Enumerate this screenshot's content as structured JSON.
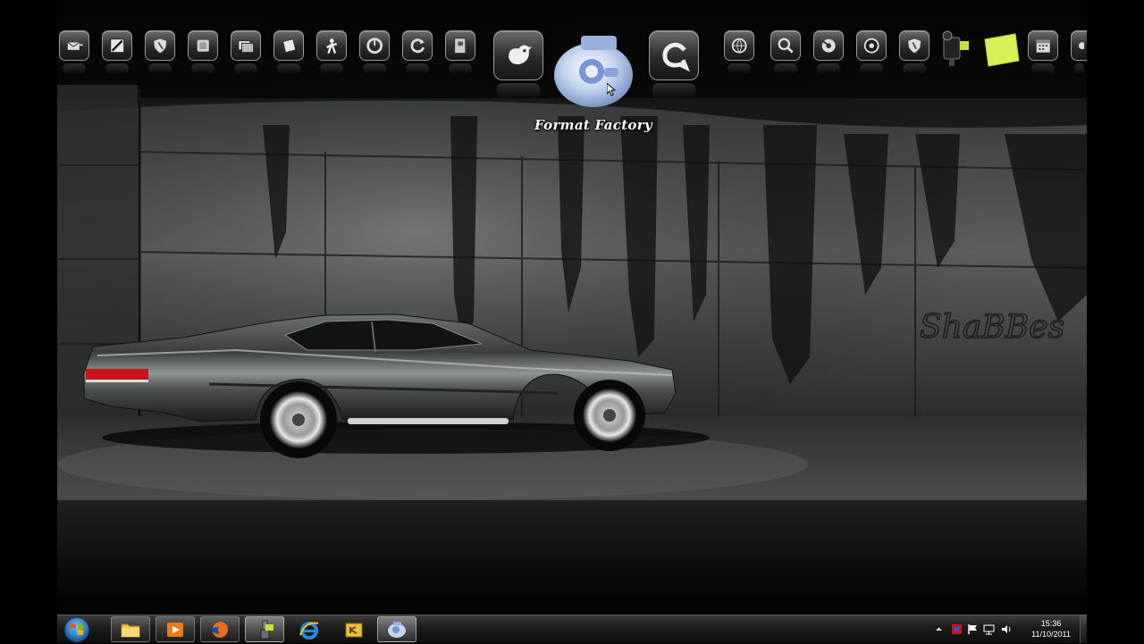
{
  "dock": {
    "hover_label": "Format Factory",
    "icons": [
      "email-icon",
      "draw-icon",
      "shield-icon",
      "app-icon",
      "gallery-icon",
      "note-icon",
      "aim-icon",
      "ccleaner-icon",
      "reload-icon",
      "files-icon",
      "twitter-bird-icon",
      "format-factory-icon",
      "messenger-icon",
      "globe-icon",
      "search-icon",
      "media-icon",
      "speaker-icon",
      "security-icon",
      "camcorder-icon",
      "sticky-note-icon",
      "calendar-icon",
      "partial-icon"
    ]
  },
  "taskbar": {
    "start_label": "Start",
    "buttons": [
      "explorer-folder-icon",
      "media-player-icon",
      "firefox-icon",
      "paint-app-icon",
      "internet-explorer-icon",
      "key-app-icon",
      "format-factory-taskbar-icon"
    ],
    "tray": {
      "icons": [
        "tray-expand-icon",
        "antivirus-icon",
        "action-center-flag-icon",
        "network-icon",
        "volume-icon"
      ],
      "time": "15:36",
      "date": "11/10/2011"
    }
  },
  "colors": {
    "taskbar": "#1b1b1b",
    "sticky_note": "#d6f05a",
    "firefox": "#e8701a",
    "ie_blue": "#2a8ad8",
    "folder_yellow": "#f0c750"
  }
}
